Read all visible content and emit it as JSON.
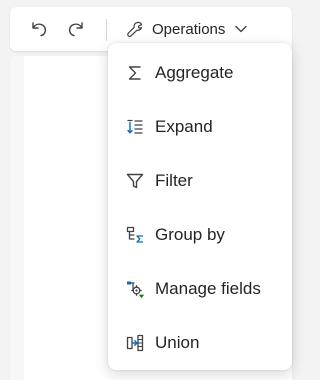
{
  "toolbar": {
    "undo_icon": "undo-icon",
    "redo_icon": "redo-icon",
    "operations_label": "Operations",
    "operations_icon": "wrench-icon"
  },
  "menu": {
    "items": [
      {
        "label": "Aggregate",
        "icon": "sigma-icon"
      },
      {
        "label": "Expand",
        "icon": "expand-list-icon"
      },
      {
        "label": "Filter",
        "icon": "funnel-icon"
      },
      {
        "label": "Group by",
        "icon": "group-by-icon"
      },
      {
        "label": "Manage fields",
        "icon": "manage-fields-icon"
      },
      {
        "label": "Union",
        "icon": "union-icon"
      }
    ]
  },
  "colors": {
    "accent_blue": "#0f6cbd",
    "accent_green": "#107c10",
    "text": "#242424"
  }
}
